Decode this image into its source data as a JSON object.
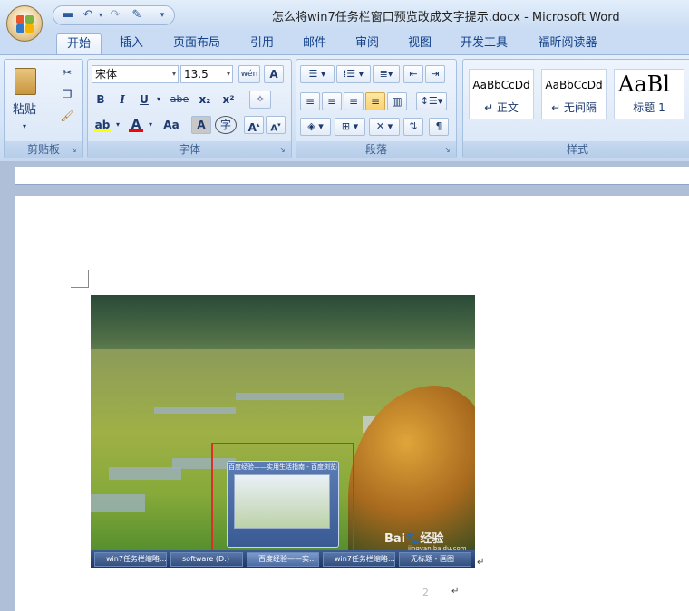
{
  "titlebar": {
    "title": "怎么将win7任务栏窗口预览改成文字提示.docx - Microsoft Word"
  },
  "qat": {
    "icons": [
      "save-icon",
      "undo-icon",
      "redo-icon",
      "format-painter-icon",
      "customize-icon"
    ]
  },
  "tabs": [
    "开始",
    "插入",
    "页面布局",
    "引用",
    "邮件",
    "审阅",
    "视图",
    "开发工具",
    "福昕阅读器"
  ],
  "ribbon": {
    "clipboard": {
      "label": "剪贴板",
      "paste_label": "粘贴"
    },
    "font": {
      "label": "字体",
      "font_name": "宋体",
      "font_size": "13.5",
      "bold": "B",
      "italic": "I",
      "underline": "U",
      "strike": "abe",
      "subscript": "x₂",
      "superscript": "x²",
      "grow": "A",
      "shrink": "A",
      "case": "Aa",
      "phonetic": "wén",
      "border_char": "A",
      "shade_char": "A",
      "enclose": "字"
    },
    "paragraph": {
      "label": "段落"
    },
    "styles": {
      "label": "样式",
      "items": [
        {
          "sample": "AaBbCcDd",
          "name": "↵ 正文"
        },
        {
          "sample": "AaBbCcDd",
          "name": "↵ 无间隔"
        },
        {
          "sample": "AaBl",
          "name": "标题 1"
        }
      ]
    }
  },
  "photo": {
    "preview_caption": "百度经验——实用生活指南 - 百度浏览器",
    "watermark": "Bai🐾经验",
    "watermark_url": "jingyan.baidu.com",
    "taskbar_items": [
      "win7任务栏缩略…",
      "software (D:)",
      "百度经验——实…",
      "win7任务栏缩略…",
      "无标题 - 画图"
    ]
  },
  "document": {
    "para_mark": "↵",
    "page_number": "2"
  },
  "colors": {
    "highlight": "#ffff00",
    "font_color": "#ff0000",
    "red_frame": "#d8302a"
  }
}
